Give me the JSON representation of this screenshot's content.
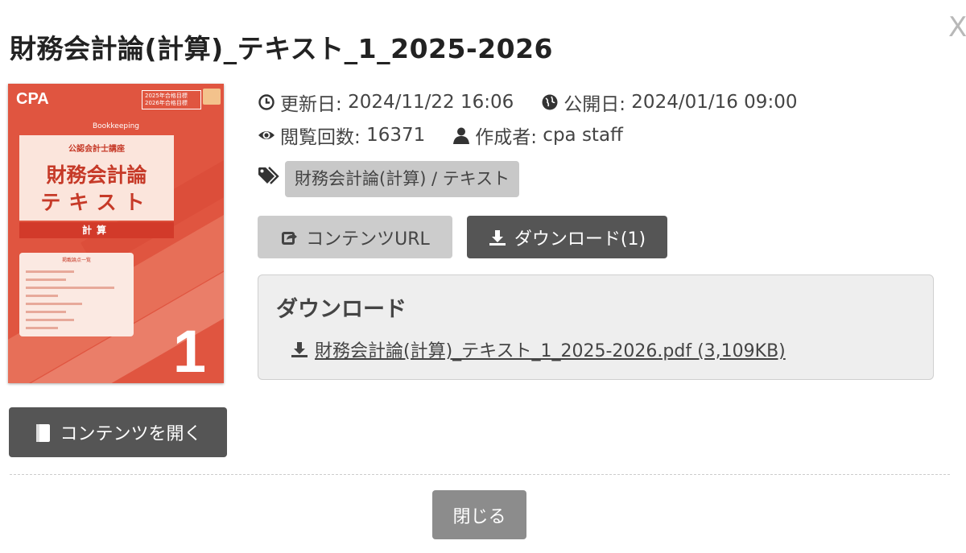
{
  "modal": {
    "title": "財務会計論(計算)_テキスト_1_2025-2026",
    "close_label": "X"
  },
  "cover": {
    "logo": "CPA",
    "years": [
      "2025年合格目標",
      "2026年合格目標"
    ],
    "subtitle_en": "Bookkeeping",
    "course": "公認会計士講座",
    "title_line1": "財務会計論",
    "title_line2": "テキスト",
    "band": "計算",
    "box_heading": "掲載論点一覧",
    "volume": "1"
  },
  "meta": {
    "updated_label": "更新日:",
    "updated_value": "2024/11/22 16:06",
    "published_label": "公開日:",
    "published_value": "2024/01/16 09:00",
    "views_label": "閲覧回数:",
    "views_value": "16371",
    "author_label": "作成者:",
    "author_value": "cpa staff"
  },
  "tag": {
    "label": "財務会計論(計算) / テキスト"
  },
  "buttons": {
    "content_url": "コンテンツURL",
    "download": "ダウンロード(1)",
    "open_content": "コンテンツを開く",
    "close": "閉じる"
  },
  "download_panel": {
    "title": "ダウンロード",
    "file_link": "財務会計論(計算)_テキスト_1_2025-2026.pdf (3,109KB)"
  },
  "colors": {
    "dark_button": "#555555",
    "light_button": "#cccccc",
    "close_button": "#8c8c8c",
    "cover_red": "#e05540"
  },
  "icons": {
    "updated": "clock-icon",
    "published": "globe-icon",
    "views": "eye-icon",
    "author": "user-icon",
    "tag": "tags-icon",
    "content_url": "share-icon",
    "download": "download-icon",
    "open": "book-icon"
  }
}
